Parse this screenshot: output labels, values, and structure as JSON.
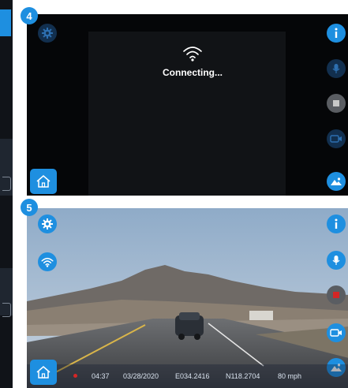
{
  "steps": {
    "step4": "4",
    "step5": "5"
  },
  "connecting": {
    "text": "Connecting..."
  },
  "status": {
    "time": "04:37",
    "date": "03/28/2020",
    "longitude": "E034.2416",
    "latitude": "N118.2704",
    "speed": "80 mph"
  },
  "icons": {
    "settings": "gear-icon",
    "info": "info-icon",
    "mic": "microphone-icon",
    "stop": "stop-icon",
    "record": "record-icon",
    "video": "video-camera-icon",
    "gallery": "image-gallery-icon",
    "home": "home-icon",
    "wifi": "wifi-icon"
  },
  "colors": {
    "accent": "#1e8fe0",
    "record": "#d42626",
    "screen_bg": "#050608"
  }
}
